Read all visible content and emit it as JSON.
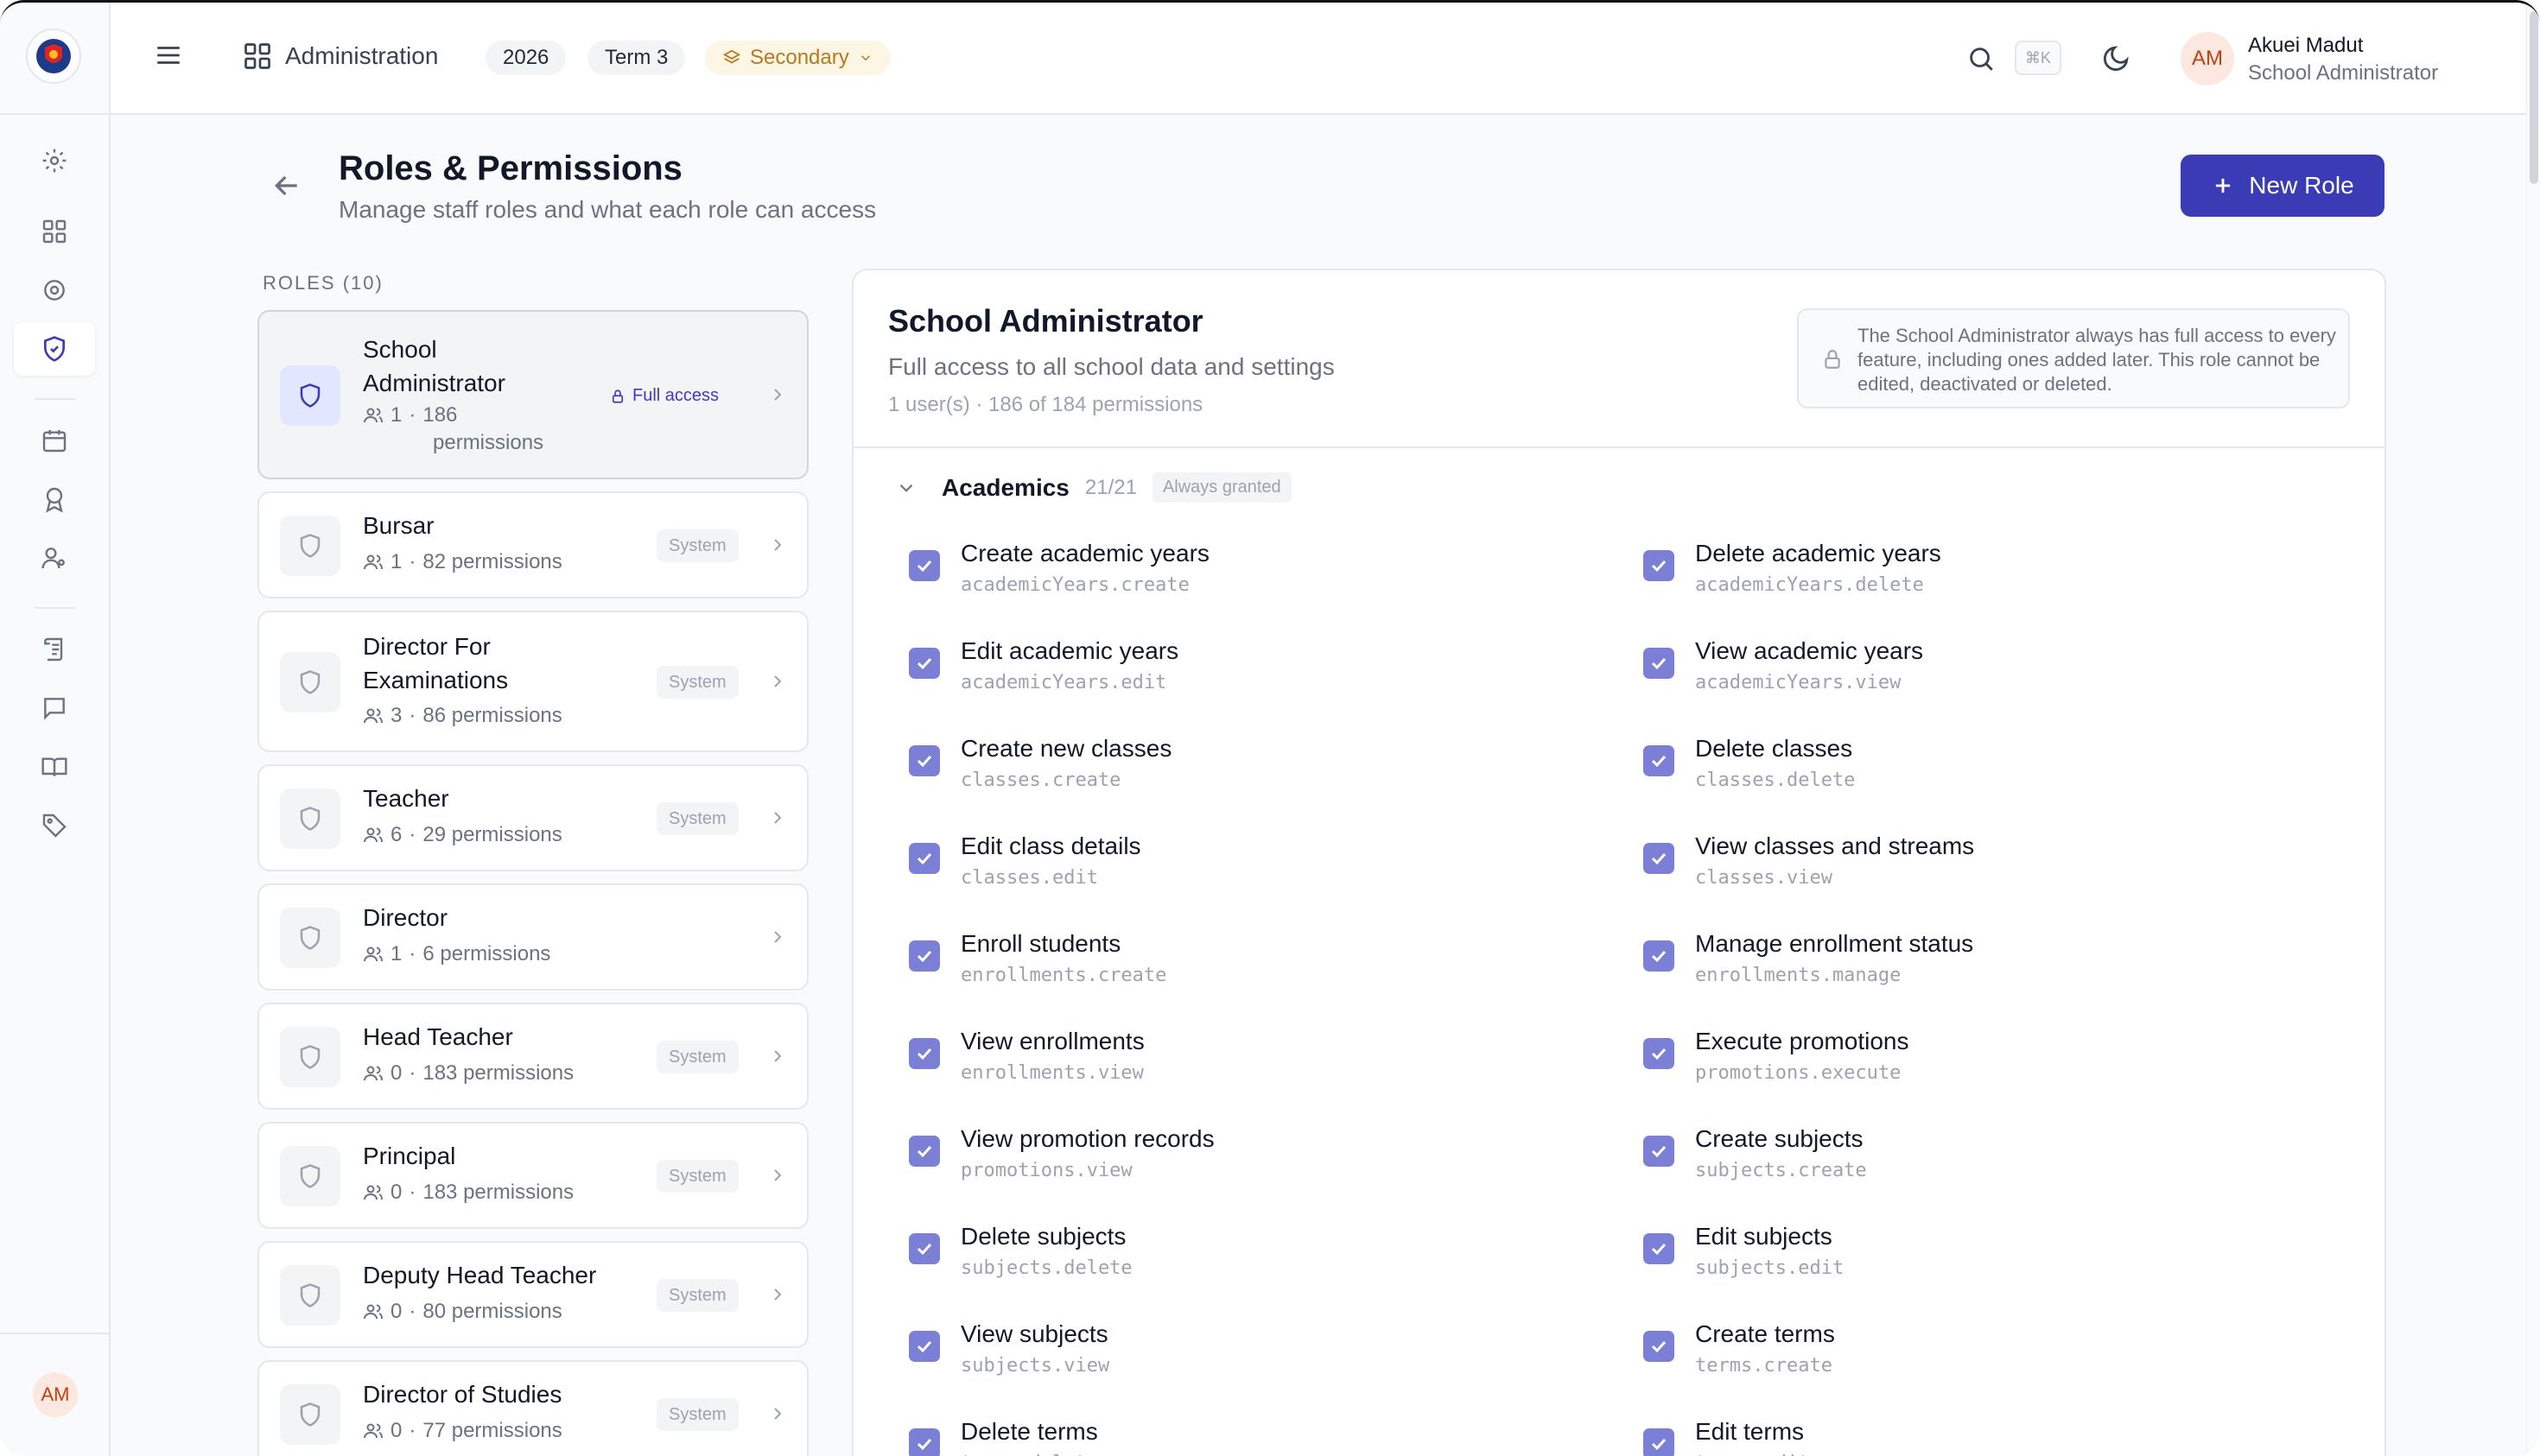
{
  "header": {
    "breadcrumb": "Administration",
    "year": "2026",
    "term": "Term 3",
    "level": "Secondary",
    "shortcut": "⌘K",
    "user_initials": "AM",
    "user_name": "Akuei Madut",
    "user_role": "School Administrator"
  },
  "sidebar": {
    "user_initials": "AM"
  },
  "page": {
    "title": "Roles & Permissions",
    "subtitle": "Manage staff roles and what each role can access",
    "new_role_label": "New Role"
  },
  "roles_heading": "ROLES (10)",
  "roles": [
    {
      "name_l1": "School",
      "name_l2": "Administrator",
      "users": "1",
      "perm_l1": "186",
      "perm_l2": "permissions",
      "badge": "Full access"
    },
    {
      "name_l1": "Bursar",
      "name_l2": "",
      "users": "1",
      "perm_l1": "82 permissions",
      "perm_l2": "",
      "badge": "System"
    },
    {
      "name_l1": "Director For",
      "name_l2": "Examinations",
      "users": "3",
      "perm_l1": "86 permissions",
      "perm_l2": "",
      "badge": "System"
    },
    {
      "name_l1": "Teacher",
      "name_l2": "",
      "users": "6",
      "perm_l1": "29 permissions",
      "perm_l2": "",
      "badge": "System"
    },
    {
      "name_l1": "Director",
      "name_l2": "",
      "users": "1",
      "perm_l1": "6 permissions",
      "perm_l2": "",
      "badge": ""
    },
    {
      "name_l1": "Head Teacher",
      "name_l2": "",
      "users": "0",
      "perm_l1": "183 permissions",
      "perm_l2": "",
      "badge": "System"
    },
    {
      "name_l1": "Principal",
      "name_l2": "",
      "users": "0",
      "perm_l1": "183 permissions",
      "perm_l2": "",
      "badge": "System"
    },
    {
      "name_l1": "Deputy Head Teacher",
      "name_l2": "",
      "users": "0",
      "perm_l1": "80 permissions",
      "perm_l2": "",
      "badge": "System"
    },
    {
      "name_l1": "Director of Studies",
      "name_l2": "",
      "users": "0",
      "perm_l1": "77 permissions",
      "perm_l2": "",
      "badge": "System"
    }
  ],
  "detail": {
    "title": "School Administrator",
    "subtitle": "Full access to all school data and settings",
    "counts": "1 user(s) · 186 of 184 permissions",
    "notice": "The School Administrator always has full access to every feature, including ones added later. This role cannot be edited, deactivated or deleted.",
    "section_name": "Academics",
    "section_count": "21/21",
    "section_badge": "Always granted"
  },
  "permissions": [
    {
      "label": "Create academic years",
      "key": "academicYears.create"
    },
    {
      "label": "Delete academic years",
      "key": "academicYears.delete"
    },
    {
      "label": "Edit academic years",
      "key": "academicYears.edit"
    },
    {
      "label": "View academic years",
      "key": "academicYears.view"
    },
    {
      "label": "Create new classes",
      "key": "classes.create"
    },
    {
      "label": "Delete classes",
      "key": "classes.delete"
    },
    {
      "label": "Edit class details",
      "key": "classes.edit"
    },
    {
      "label": "View classes and streams",
      "key": "classes.view"
    },
    {
      "label": "Enroll students",
      "key": "enrollments.create"
    },
    {
      "label": "Manage enrollment status",
      "key": "enrollments.manage"
    },
    {
      "label": "View enrollments",
      "key": "enrollments.view"
    },
    {
      "label": "Execute promotions",
      "key": "promotions.execute"
    },
    {
      "label": "View promotion records",
      "key": "promotions.view"
    },
    {
      "label": "Create subjects",
      "key": "subjects.create"
    },
    {
      "label": "Delete subjects",
      "key": "subjects.delete"
    },
    {
      "label": "Edit subjects",
      "key": "subjects.edit"
    },
    {
      "label": "View subjects",
      "key": "subjects.view"
    },
    {
      "label": "Create terms",
      "key": "terms.create"
    },
    {
      "label": "Delete terms",
      "key": "terms.delete"
    },
    {
      "label": "Edit terms",
      "key": "terms.edit"
    }
  ]
}
